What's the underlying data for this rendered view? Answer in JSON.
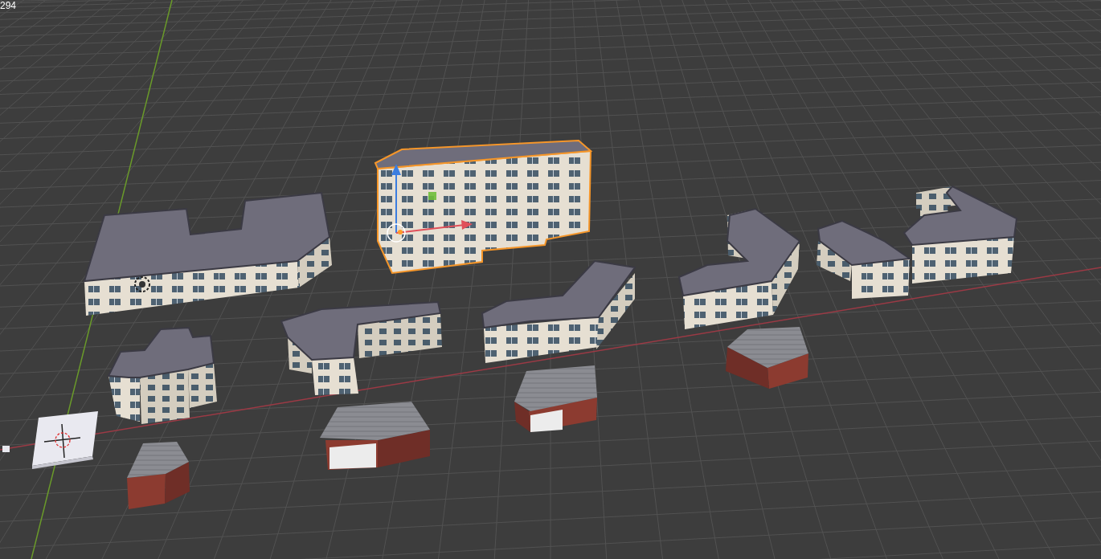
{
  "viewport": {
    "overlay_text": "294"
  }
}
